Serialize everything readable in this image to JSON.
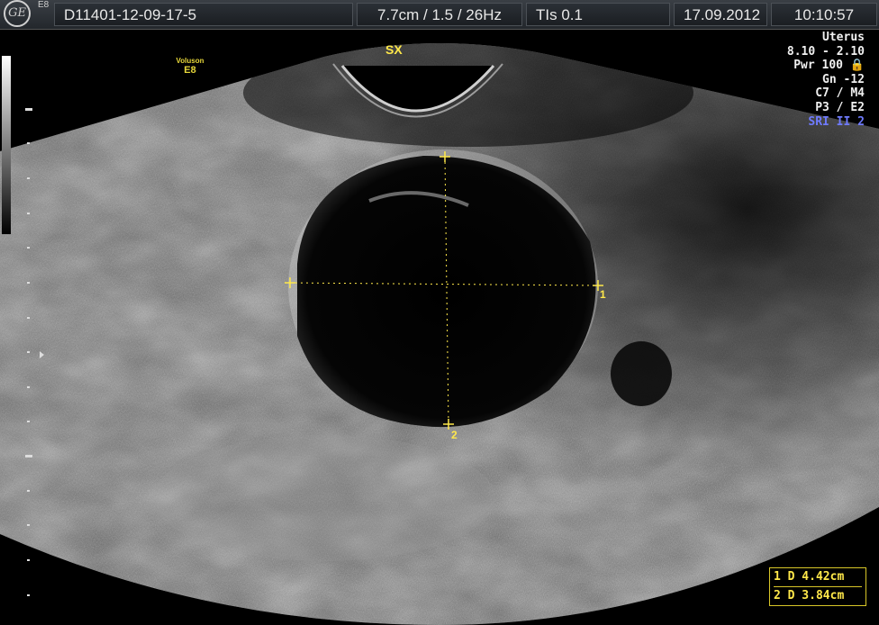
{
  "header": {
    "model": "E8",
    "patient_id": "D11401-12-09-17-5",
    "probe_settings": "7.7cm / 1.5 / 26Hz",
    "thermal_index": "TIs  0.1",
    "date": "17.09.2012",
    "time": "10:10:57"
  },
  "brand": {
    "line1": "Voluson",
    "line2": "E8"
  },
  "side_label": "SX",
  "params": {
    "preset": "Uterus",
    "frequency": "8.10 - 2.10",
    "power": "Pwr 100 🔒",
    "gain": "Gn -12",
    "c_m": "C7 / M4",
    "p_e": "P3 / E2",
    "sri": "SRI II 2"
  },
  "measurements": [
    {
      "label": "1",
      "value": "D 4.42cm"
    },
    {
      "label": "2",
      "value": "D 3.84cm"
    }
  ],
  "calipers": {
    "line1_label": "1",
    "line2_label": "2"
  },
  "colors": {
    "caliper": "#ffe84a",
    "sri": "#6f7bff"
  }
}
